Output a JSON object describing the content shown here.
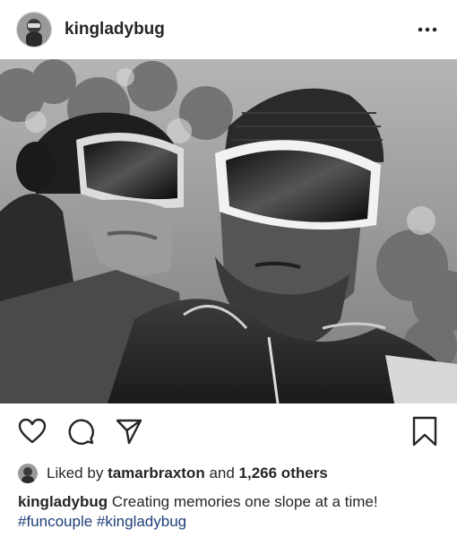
{
  "header": {
    "username": "kingladybug",
    "more_icon": "more-horizontal-icon"
  },
  "post": {
    "image_description_icon": "ski-selfie-photo"
  },
  "actions": {
    "icons": [
      "heart-icon",
      "comment-icon",
      "share-icon",
      "bookmark-icon"
    ]
  },
  "likes": {
    "prefix": "Liked by",
    "user": "tamarbraxton",
    "middle": "and",
    "others": "1,266 others"
  },
  "caption": {
    "username": "kingladybug",
    "text": "Creating memories one slope at a time!",
    "hashtags": [
      "#funcouple",
      "#kingladybug"
    ]
  }
}
